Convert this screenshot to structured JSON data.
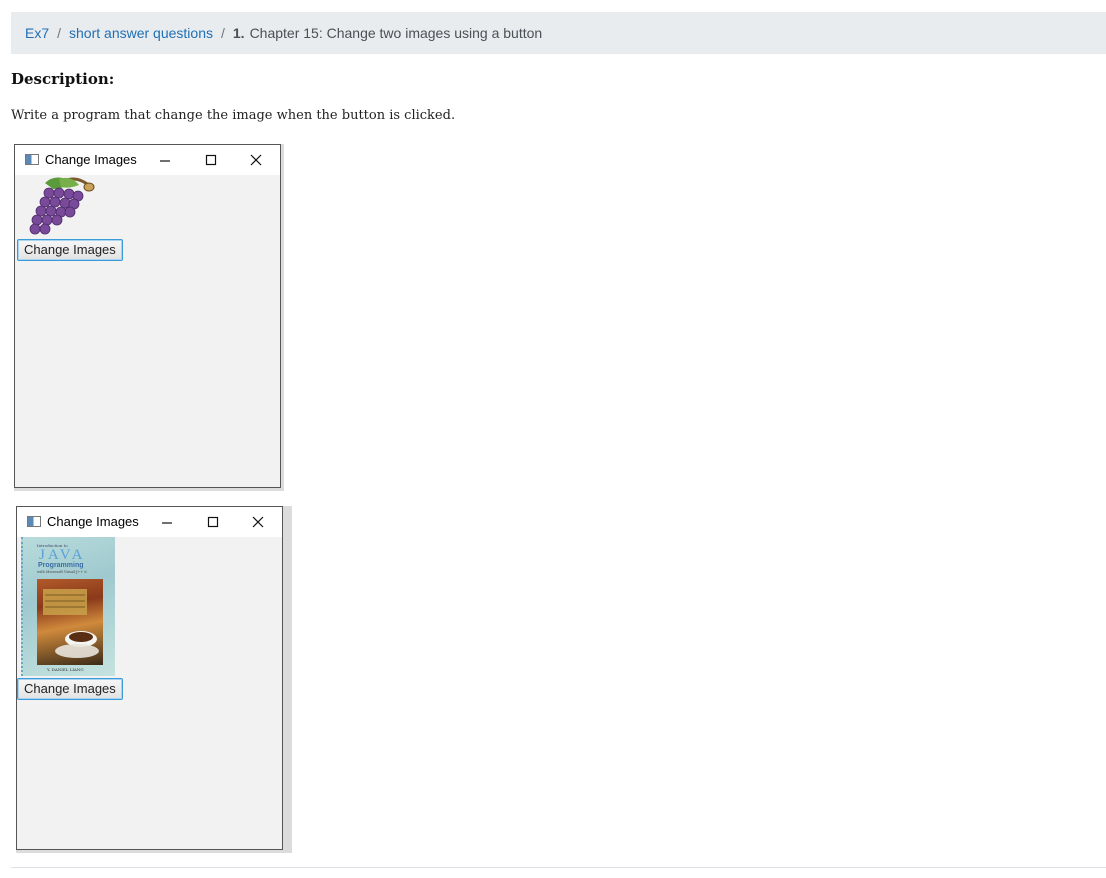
{
  "breadcrumb": {
    "items": [
      "Ex7",
      "short answer questions"
    ],
    "separator": "/",
    "current_number": "1.",
    "current_title": "Chapter 15: Change two images using a button"
  },
  "description": {
    "heading": "Description:",
    "text": "Write a program that change the image when the button is clicked."
  },
  "windows": [
    {
      "title": "Change Images",
      "button_label": "Change Images",
      "image": "grapes-image"
    },
    {
      "title": "Change Images",
      "button_label": "Change Images",
      "image": "java-book-cover-image",
      "book": {
        "small_text": "Introduction to",
        "title": "JAVA",
        "subtitle": "Programming",
        "tagline": "with Microsoft Visual J++ 6",
        "author": "Y. DANIEL LIANG"
      }
    }
  ],
  "icons": {
    "minimize": "minimize-icon",
    "maximize": "maximize-icon",
    "close": "close-icon",
    "app": "java-app-icon"
  },
  "colors": {
    "link": "#1f6fb5",
    "breadcrumb_bg": "#e9ecef",
    "button_focus": "#3a9bd8"
  }
}
